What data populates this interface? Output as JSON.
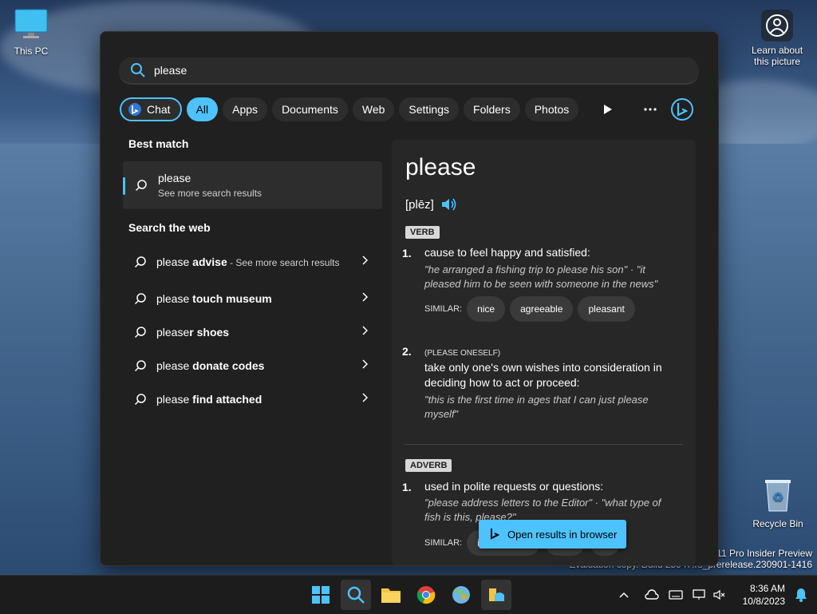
{
  "desktop": {
    "this_pc_label": "This PC",
    "recycle_bin_label": "Recycle Bin",
    "learn_label": "Learn about this picture",
    "watermark_line1": "s 11 Pro Insider Preview",
    "watermark_line2": "Evaluation copy. Build 25947.rs_prerelease.230901-1416"
  },
  "search": {
    "query": "please"
  },
  "filters": [
    "Chat",
    "All",
    "Apps",
    "Documents",
    "Web",
    "Settings",
    "Folders",
    "Photos"
  ],
  "best_match": {
    "title": "Best match",
    "item_title": "please",
    "item_sub": "See more search results"
  },
  "search_web": {
    "title": "Search the web",
    "items": [
      {
        "prefix": "please ",
        "bold": "advise",
        "suffix": " - See more search results"
      },
      {
        "prefix": "please ",
        "bold": "touch museum",
        "suffix": ""
      },
      {
        "prefix": "please",
        "bold": "r shoes",
        "suffix": ""
      },
      {
        "prefix": "please ",
        "bold": "donate codes",
        "suffix": ""
      },
      {
        "prefix": "please ",
        "bold": "find attached",
        "suffix": ""
      }
    ]
  },
  "definition": {
    "word": "please",
    "pronunciation": "[plēz]",
    "pos1": "VERB",
    "def1_num": "1.",
    "def1": "cause to feel happy and satisfied:",
    "def1_example": "\"he arranged a fishing trip to please his son\" · \"it pleased him to be seen with someone in the news\"",
    "similar_label": "SIMILAR:",
    "similar1": [
      "nice",
      "agreeable",
      "pleasant"
    ],
    "def2_num": "2.",
    "def2_tag": "(PLEASE ONESELF)",
    "def2": "take only one's own wishes into consideration in deciding how to act or proceed:",
    "def2_example": "\"this is the first time in ages that I can just please myself\"",
    "pos2": "ADVERB",
    "def3_num": "1.",
    "def3": "used in polite requests or questions:",
    "def3_example": "\"please address letters to the Editor\" · \"what type of fish is this, please?\"",
    "similar2_first": "if",
    "open_browser": "Open results in browser"
  },
  "taskbar": {
    "time": "8:36 AM",
    "date": "10/8/2023"
  },
  "colors": {
    "accent": "#4cc2ff",
    "panel": "#202020"
  }
}
